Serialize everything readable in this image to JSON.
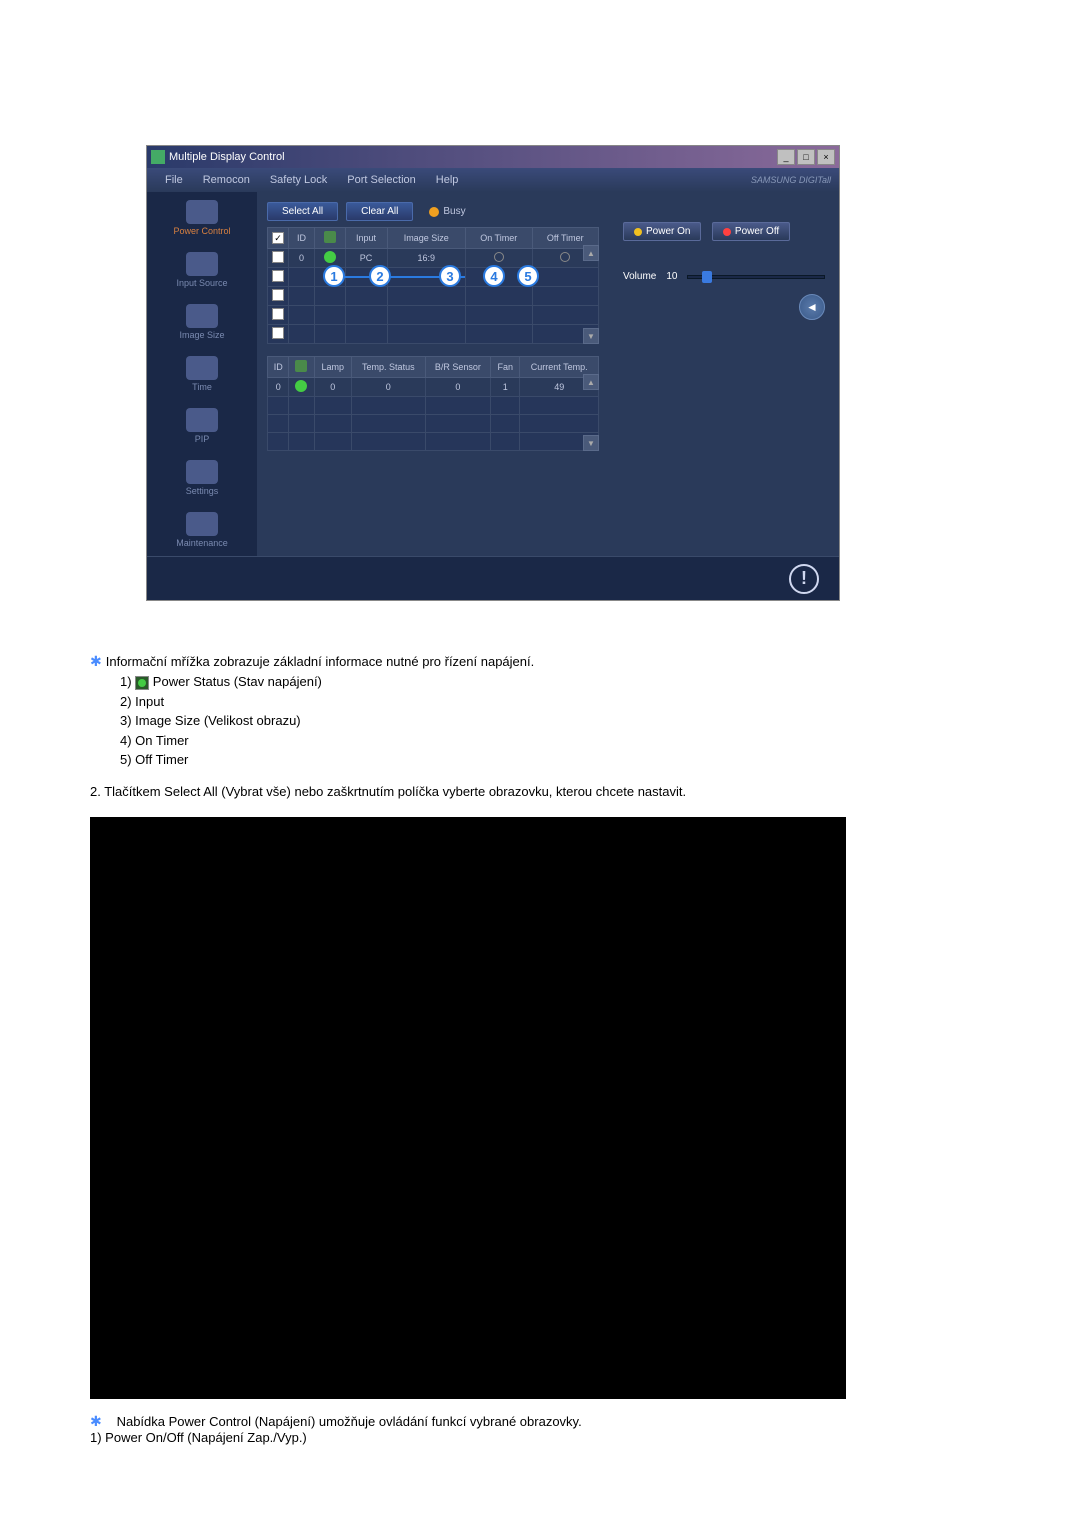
{
  "window": {
    "title": "Multiple Display Control",
    "brand": "SAMSUNG DIGITall"
  },
  "menu": [
    "File",
    "Remocon",
    "Safety Lock",
    "Port Selection",
    "Help"
  ],
  "sidebar": [
    {
      "label": "Power Control",
      "orange": true
    },
    {
      "label": "Input Source"
    },
    {
      "label": "Image Size"
    },
    {
      "label": "Time"
    },
    {
      "label": "PIP"
    },
    {
      "label": "Settings"
    },
    {
      "label": "Maintenance"
    }
  ],
  "toolbar": {
    "select_all": "Select All",
    "clear_all": "Clear All",
    "busy": "Busy"
  },
  "grid1": {
    "headers": [
      "",
      "ID",
      "",
      "Input",
      "Image Size",
      "On Timer",
      "Off Timer"
    ],
    "rows": [
      {
        "checked": true,
        "id": "0",
        "status": "green",
        "input": "PC",
        "image_size": "16:9",
        "on_timer": "○",
        "off_timer": "○"
      }
    ]
  },
  "callouts": [
    "1",
    "2",
    "3",
    "4",
    "5"
  ],
  "grid2": {
    "headers": [
      "ID",
      "",
      "Lamp",
      "Temp. Status",
      "B/R Sensor",
      "Fan",
      "Current Temp."
    ],
    "rows": [
      {
        "id": "0",
        "status": "green",
        "lamp": "0",
        "temp_status": "0",
        "br_sensor": "0",
        "fan": "1",
        "current_temp": "49"
      }
    ]
  },
  "right": {
    "power_on": "Power On",
    "power_off": "Power Off",
    "volume_label": "Volume",
    "volume_value": "10"
  },
  "description": {
    "intro": "Informační mřížka zobrazuje základní informace nutné pro řízení napájení.",
    "items": [
      "Power Status (Stav napájení)",
      "Input",
      "Image Size (Velikost obrazu)",
      "On Timer",
      "Off Timer"
    ]
  },
  "desc2": "2.  Tlačítkem Select All (Vybrat vše) nebo zaškrtnutím políčka vyberte obrazovku, kterou chcete nastavit.",
  "desc3_line1": "Nabídka Power Control (Napájení) umožňuje ovládání funkcí vybrané obrazovky.",
  "desc3_line2": "1)  Power On/Off (Napájení Zap./Vyp.)"
}
